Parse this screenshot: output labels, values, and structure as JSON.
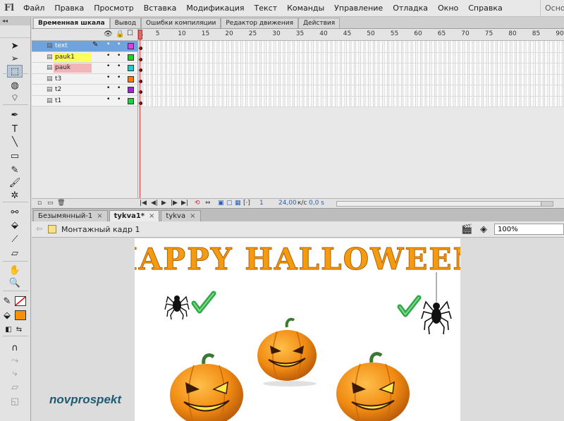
{
  "app": {
    "logo": "Fl",
    "menu": [
      "Файл",
      "Правка",
      "Просмотр",
      "Вставка",
      "Модификация",
      "Текст",
      "Команды",
      "Управление",
      "Отладка",
      "Окно",
      "Справка"
    ],
    "search_stub": "Осно"
  },
  "toolbar": {
    "collapse_glyph": "◂◂",
    "tools": [
      {
        "name": "selection-tool-icon",
        "glyph": "➤"
      },
      {
        "name": "subselection-tool-icon",
        "glyph": "➢"
      },
      {
        "name": "free-transform-tool-icon",
        "glyph": "⬚"
      },
      {
        "name": "3d-rotation-tool-icon",
        "glyph": "◍"
      },
      {
        "name": "lasso-tool-icon",
        "glyph": "⌔"
      },
      {
        "name": "pen-tool-icon",
        "glyph": "✒"
      },
      {
        "name": "text-tool-icon",
        "glyph": "T"
      },
      {
        "name": "line-tool-icon",
        "glyph": "╲"
      },
      {
        "name": "rectangle-tool-icon",
        "glyph": "▭"
      },
      {
        "name": "pencil-tool-icon",
        "glyph": "✎"
      },
      {
        "name": "brush-tool-icon",
        "glyph": "🖌"
      },
      {
        "name": "deco-tool-icon",
        "glyph": "✲"
      },
      {
        "name": "bone-tool-icon",
        "glyph": "⚯"
      },
      {
        "name": "paint-bucket-tool-icon",
        "glyph": "⬙"
      },
      {
        "name": "eyedropper-tool-icon",
        "glyph": "⟋"
      },
      {
        "name": "eraser-tool-icon",
        "glyph": "▱"
      },
      {
        "name": "hand-tool-icon",
        "glyph": "✋"
      },
      {
        "name": "zoom-tool-icon",
        "glyph": "🔍"
      }
    ],
    "stroke_color": "#ffffff",
    "fill_color": "#f5900a",
    "extra_tools": [
      {
        "name": "snap-magnet-icon",
        "glyph": "∩"
      },
      {
        "name": "smooth-icon",
        "glyph": "⤳"
      },
      {
        "name": "straighten-icon",
        "glyph": "⤷"
      },
      {
        "name": "option-icon-a",
        "glyph": "▱"
      },
      {
        "name": "option-icon-b",
        "glyph": "◱"
      }
    ]
  },
  "timeline": {
    "tabs": [
      "Временная шкала",
      "Вывод",
      "Ошибки компиляции",
      "Редактор движения",
      "Действия"
    ],
    "active_tab": 0,
    "layers": [
      {
        "name": "text",
        "color": "#e040e0",
        "selected": true,
        "highlight": ""
      },
      {
        "name": "pauk1",
        "color": "#22cc22",
        "selected": false,
        "highlight": "yellow"
      },
      {
        "name": "pauk",
        "color": "#22cccc",
        "selected": false,
        "highlight": "pink"
      },
      {
        "name": "t3",
        "color": "#ff7a00",
        "selected": false,
        "highlight": ""
      },
      {
        "name": "t2",
        "color": "#9a2ad0",
        "selected": false,
        "highlight": ""
      },
      {
        "name": "t1",
        "color": "#22cc44",
        "selected": false,
        "highlight": ""
      }
    ],
    "ruler": [
      "1",
      "5",
      "10",
      "15",
      "20",
      "25",
      "30",
      "35",
      "40",
      "45",
      "50",
      "55",
      "60",
      "65",
      "70",
      "75",
      "80",
      "85",
      "90"
    ],
    "current_frame": "1",
    "fps": "24,00",
    "fps_unit": "к/с",
    "time": "0,0 s"
  },
  "documents": {
    "tabs": [
      "Безымянный-1",
      "tykva1*",
      "tykva"
    ],
    "active": 1,
    "close_glyph": "×"
  },
  "editbar": {
    "scene": "Монтажный кадр 1",
    "zoom": "100%"
  },
  "stage": {
    "title": "HAPPY HALLOWEEN",
    "title_color": "#f39c12",
    "check_color": "#2ea84a",
    "watermark": "novprospekt"
  }
}
